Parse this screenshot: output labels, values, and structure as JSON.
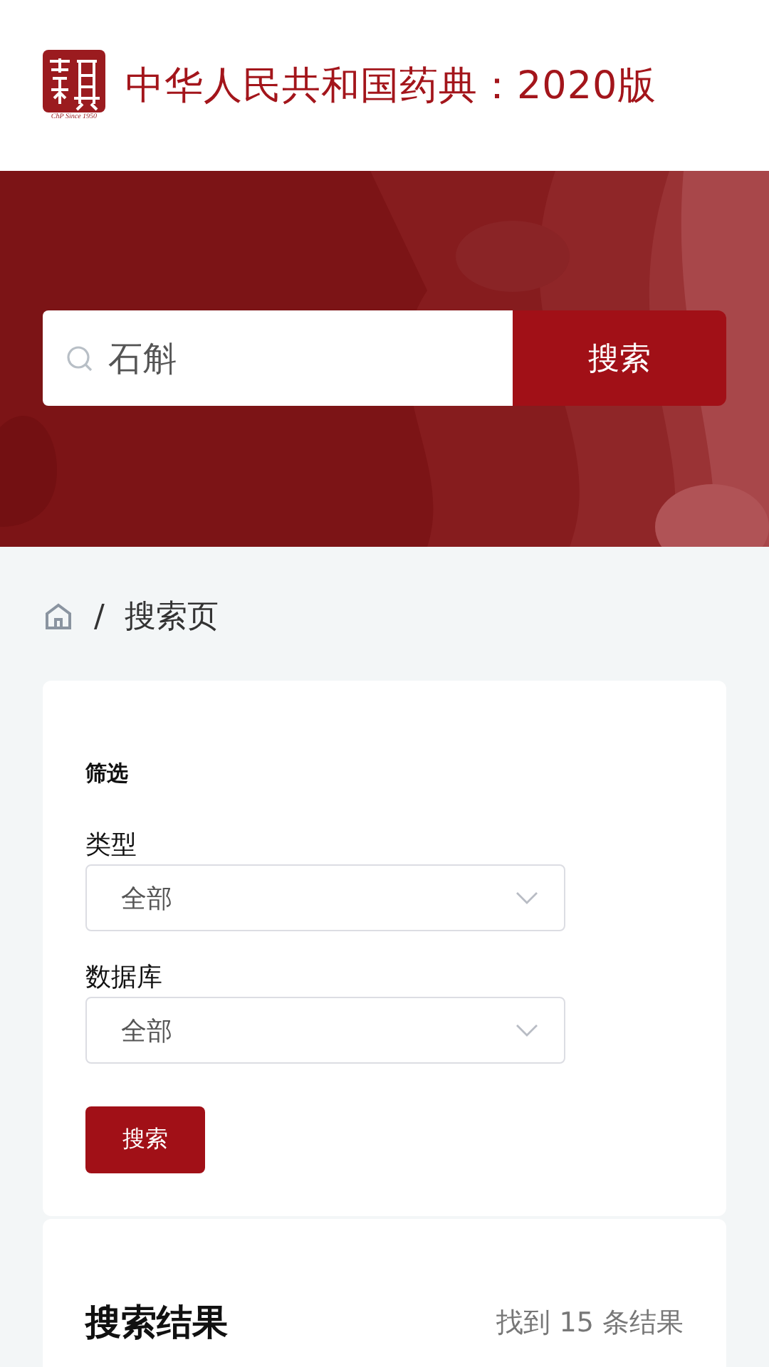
{
  "header": {
    "logo_caption": "ChP Since 1950",
    "title": "中华人民共和国药典：2020版"
  },
  "search": {
    "value": "石斛",
    "button": "搜索"
  },
  "breadcrumb": {
    "separator": "/",
    "current": "搜索页"
  },
  "filter": {
    "title": "筛选",
    "fields": [
      {
        "label": "类型",
        "value": "全部"
      },
      {
        "label": "数据库",
        "value": "全部"
      }
    ],
    "button": "搜索"
  },
  "results": {
    "title": "搜索结果",
    "count": "找到 15 条结果"
  }
}
